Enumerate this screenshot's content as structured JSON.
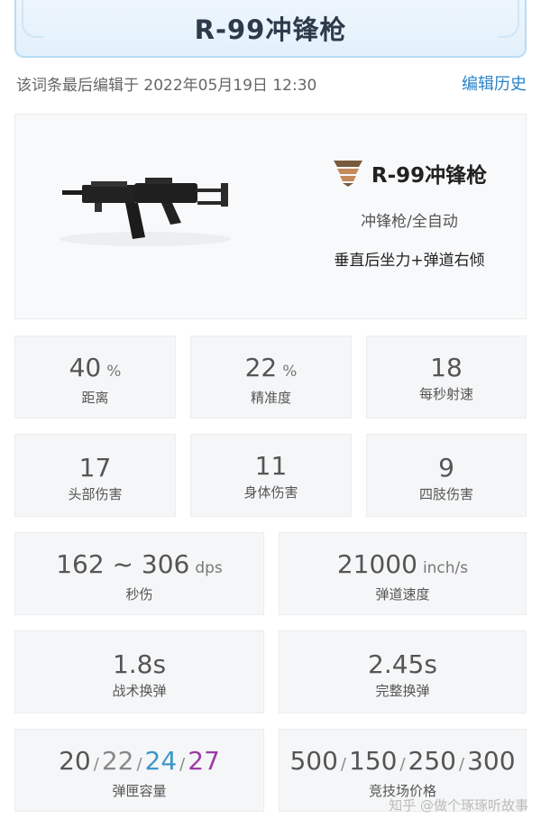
{
  "header": {
    "title": "R-99冲锋枪"
  },
  "meta": {
    "edited": "该词条最后编辑于 2022年05月19日 12:30",
    "history_link": "编辑历史"
  },
  "weapon": {
    "name": "R-99冲锋枪",
    "type": "冲锋枪/全自动",
    "recoil": "垂直后坐力+弹道右倾",
    "icon": "ammo-light-icon",
    "image": "r99-smg-image"
  },
  "stats_row1": [
    {
      "value": "40",
      "unit": "%",
      "label": "距离"
    },
    {
      "value": "22",
      "unit": "%",
      "label": "精准度"
    },
    {
      "value": "18",
      "unit": "",
      "label": "每秒射速"
    }
  ],
  "stats_row2": [
    {
      "value": "17",
      "label": "头部伤害"
    },
    {
      "value": "11",
      "label": "身体伤害"
    },
    {
      "value": "9",
      "label": "四肢伤害"
    }
  ],
  "dps": {
    "value": "162 ~ 306",
    "unit": "dps",
    "label": "秒伤"
  },
  "speed": {
    "value": "21000",
    "unit": "inch/s",
    "label": "弹道速度"
  },
  "tactical_reload": {
    "value": "1.8s",
    "label": "战术换弹"
  },
  "full_reload": {
    "value": "2.45s",
    "label": "完整换弹"
  },
  "magazine": {
    "values": [
      "20",
      "22",
      "24",
      "27"
    ],
    "separator": "/",
    "label": "弹匣容量",
    "colors": [
      "#555555",
      "#888888",
      "#3b97c9",
      "#9c3aa8"
    ]
  },
  "arena_price": {
    "values": [
      "500",
      "150",
      "250",
      "300"
    ],
    "separator": "/",
    "label": "竞技场价格"
  },
  "watermark": "知乎 @做个琢琢听故事",
  "colors": {
    "accent": "#2a83c9",
    "banner": "#e2f0fb",
    "card": "#f5f6f7"
  }
}
